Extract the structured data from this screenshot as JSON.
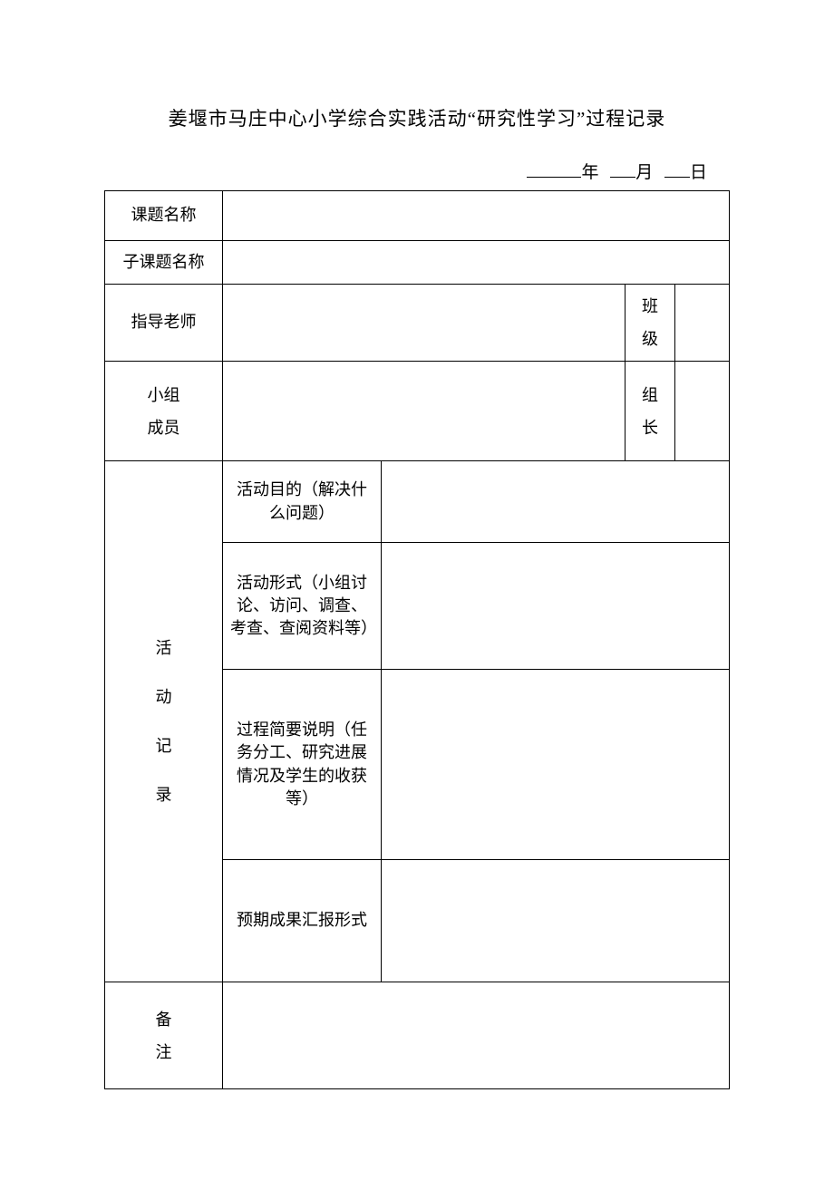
{
  "title": "姜堰市马庄中心小学综合实践活动“研究性学习”过程记录",
  "date": {
    "year_label": "年",
    "month_label": "月",
    "day_label": "日"
  },
  "rows": {
    "topic_name": "课题名称",
    "sub_topic_name": "子课题名称",
    "advisor": "指导老师",
    "class_label": "班级",
    "class_value": "",
    "group_members": "小组成员",
    "group_leader_label": "组长",
    "group_leader_value": "",
    "activity_record": "活动记录",
    "activity_record_chars": [
      "活",
      "动",
      "记",
      "录"
    ],
    "remarks": "备注",
    "sub": {
      "purpose": "活动目的（解决什么问题）",
      "format": "活动形式（小组讨论、访问、调查、考查、查阅资料等）",
      "process": "过程简要说明（任务分工、研究进展情况及学生的收获等）",
      "expected": "预期成果汇报形式"
    }
  },
  "values": {
    "topic_name": "",
    "sub_topic_name": "",
    "advisor": "",
    "group_members": "",
    "purpose": "",
    "format": "",
    "process": "",
    "expected": "",
    "remarks": ""
  }
}
